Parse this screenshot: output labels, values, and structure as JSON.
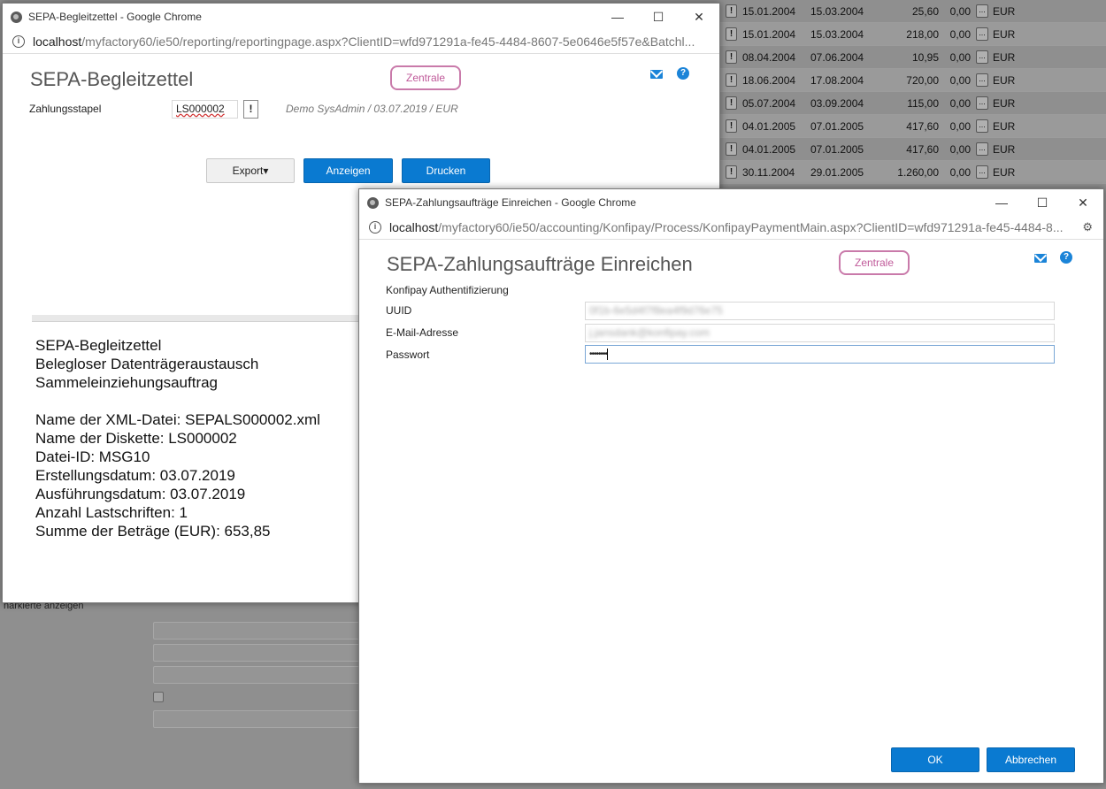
{
  "background": {
    "rows": [
      {
        "d1": "15.01.2004",
        "d2": "15.03.2004",
        "amount": "25,60",
        "fee": "0,00",
        "cur": "EUR"
      },
      {
        "d1": "15.01.2004",
        "d2": "15.03.2004",
        "amount": "218,00",
        "fee": "0,00",
        "cur": "EUR"
      },
      {
        "d1": "08.04.2004",
        "d2": "07.06.2004",
        "amount": "10,95",
        "fee": "0,00",
        "cur": "EUR"
      },
      {
        "d1": "18.06.2004",
        "d2": "17.08.2004",
        "amount": "720,00",
        "fee": "0,00",
        "cur": "EUR"
      },
      {
        "d1": "05.07.2004",
        "d2": "03.09.2004",
        "amount": "115,00",
        "fee": "0,00",
        "cur": "EUR"
      },
      {
        "d1": "04.01.2005",
        "d2": "07.01.2005",
        "amount": "417,60",
        "fee": "0,00",
        "cur": "EUR"
      },
      {
        "d1": "04.01.2005",
        "d2": "07.01.2005",
        "amount": "417,60",
        "fee": "0,00",
        "cur": "EUR"
      },
      {
        "d1": "30.11.2004",
        "d2": "29.01.2005",
        "amount": "1.260,00",
        "fee": "0,00",
        "cur": "EUR"
      }
    ],
    "marked_label": "narkierte anzeigen"
  },
  "win1": {
    "title": "SEPA-Begleitzettel - Google Chrome",
    "url_host": "localhost",
    "url_path": "/myfactory60/ie50/reporting/reportingpage.aspx?ClientID=wfd971291a-fe45-4484-8607-5e0646e5f57e&Batchl...",
    "app_title": "SEPA-Begleitzettel",
    "zentrale": "Zentrale",
    "stapel_label": "Zahlungsstapel",
    "stapel_value": "LS000002",
    "user_info": "Demo SysAdmin / 03.07.2019 / EUR",
    "btn_export": "Export▾",
    "btn_anzeigen": "Anzeigen",
    "btn_drucken": "Drucken",
    "report": {
      "line1": "SEPA-Begleitzettel",
      "line2": "Belegloser Datenträgeraustausch",
      "line3": "Sammeleinziehungsauftrag",
      "line4": "Name der XML-Datei: SEPALS000002.xml",
      "line5": "Name der Diskette: LS000002",
      "line6": "Datei-ID: MSG10",
      "line7": "Erstellungsdatum: 03.07.2019",
      "line8": "Ausführungsdatum: 03.07.2019",
      "line9": "Anzahl Lastschriften: 1",
      "line10": "Summe der Beträge (EUR): 653,85"
    }
  },
  "win2": {
    "title": "SEPA-Zahlungsaufträge Einreichen - Google Chrome",
    "url_host": "localhost",
    "url_path": "/myfactory60/ie50/accounting/Konfipay/Process/KonfipayPaymentMain.aspx?ClientID=wfd971291a-fe45-4484-8...",
    "app_title": "SEPA-Zahlungsaufträge Einreichen",
    "zentrale": "Zentrale",
    "section": "Konfipay Authentifizierung",
    "uuid_label": "UUID",
    "uuid_value": "0f1b-6e5d4f7f8ea4f9d76e75",
    "email_label": "E-Mail-Adresse",
    "email_value": "j.jansdank@konfipay.com",
    "password_label": "Passwort",
    "password_value": "••••••••",
    "btn_ok": "OK",
    "btn_cancel": "Abbrechen"
  },
  "colors": {
    "accent": "#0a7ad1",
    "zentrale": "#c97aaa"
  }
}
